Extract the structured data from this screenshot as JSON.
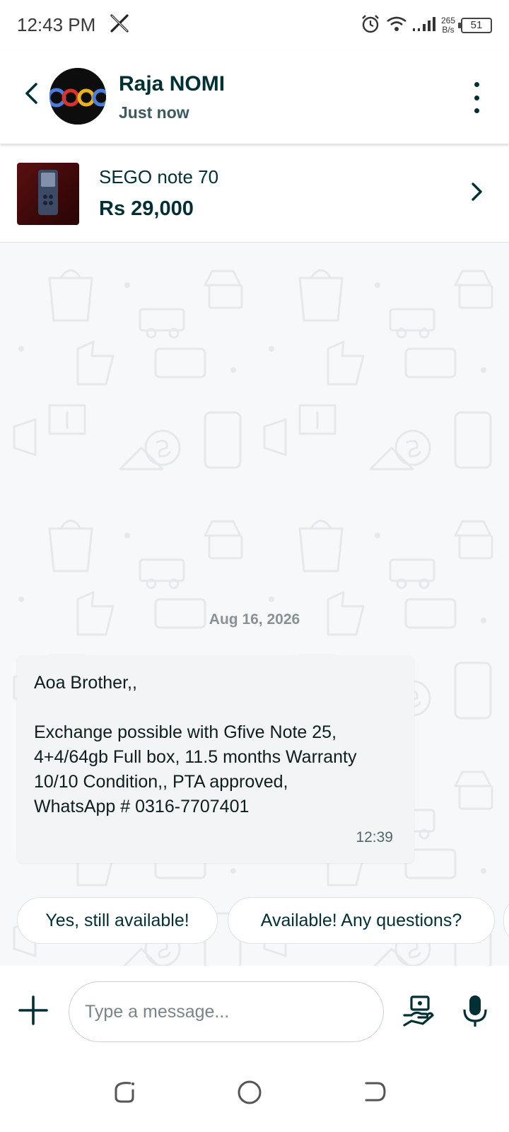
{
  "status_bar": {
    "time": "12:43 PM",
    "app_icon": "x-logo-icon",
    "net_speed_value": "265",
    "net_speed_unit": "B/s",
    "battery": "51"
  },
  "header": {
    "contact_name": "Raja NOMI",
    "contact_status": "Just now",
    "avatar_text": "oog"
  },
  "product": {
    "title": "SEGO note 70",
    "price": "Rs 29,000"
  },
  "chat": {
    "date_separator": "Aug 16, 2026",
    "messages": [
      {
        "text": "Aoa Brother,,\n\nExchange possible with Gfive Note 25,\n4+4/64gb Full box, 11.5 months Warranty\n10/10 Condition,, PTA approved,\nWhatsApp # 0316-7707401",
        "time": "12:39"
      }
    ],
    "quick_replies": [
      "Yes, still available!",
      "Available! Any questions?"
    ]
  },
  "composer": {
    "placeholder": "Type a message..."
  },
  "colors": {
    "primary": "#002f34",
    "chat_bg": "#f7f8f9",
    "bubble_bg": "#f2f4f5"
  }
}
